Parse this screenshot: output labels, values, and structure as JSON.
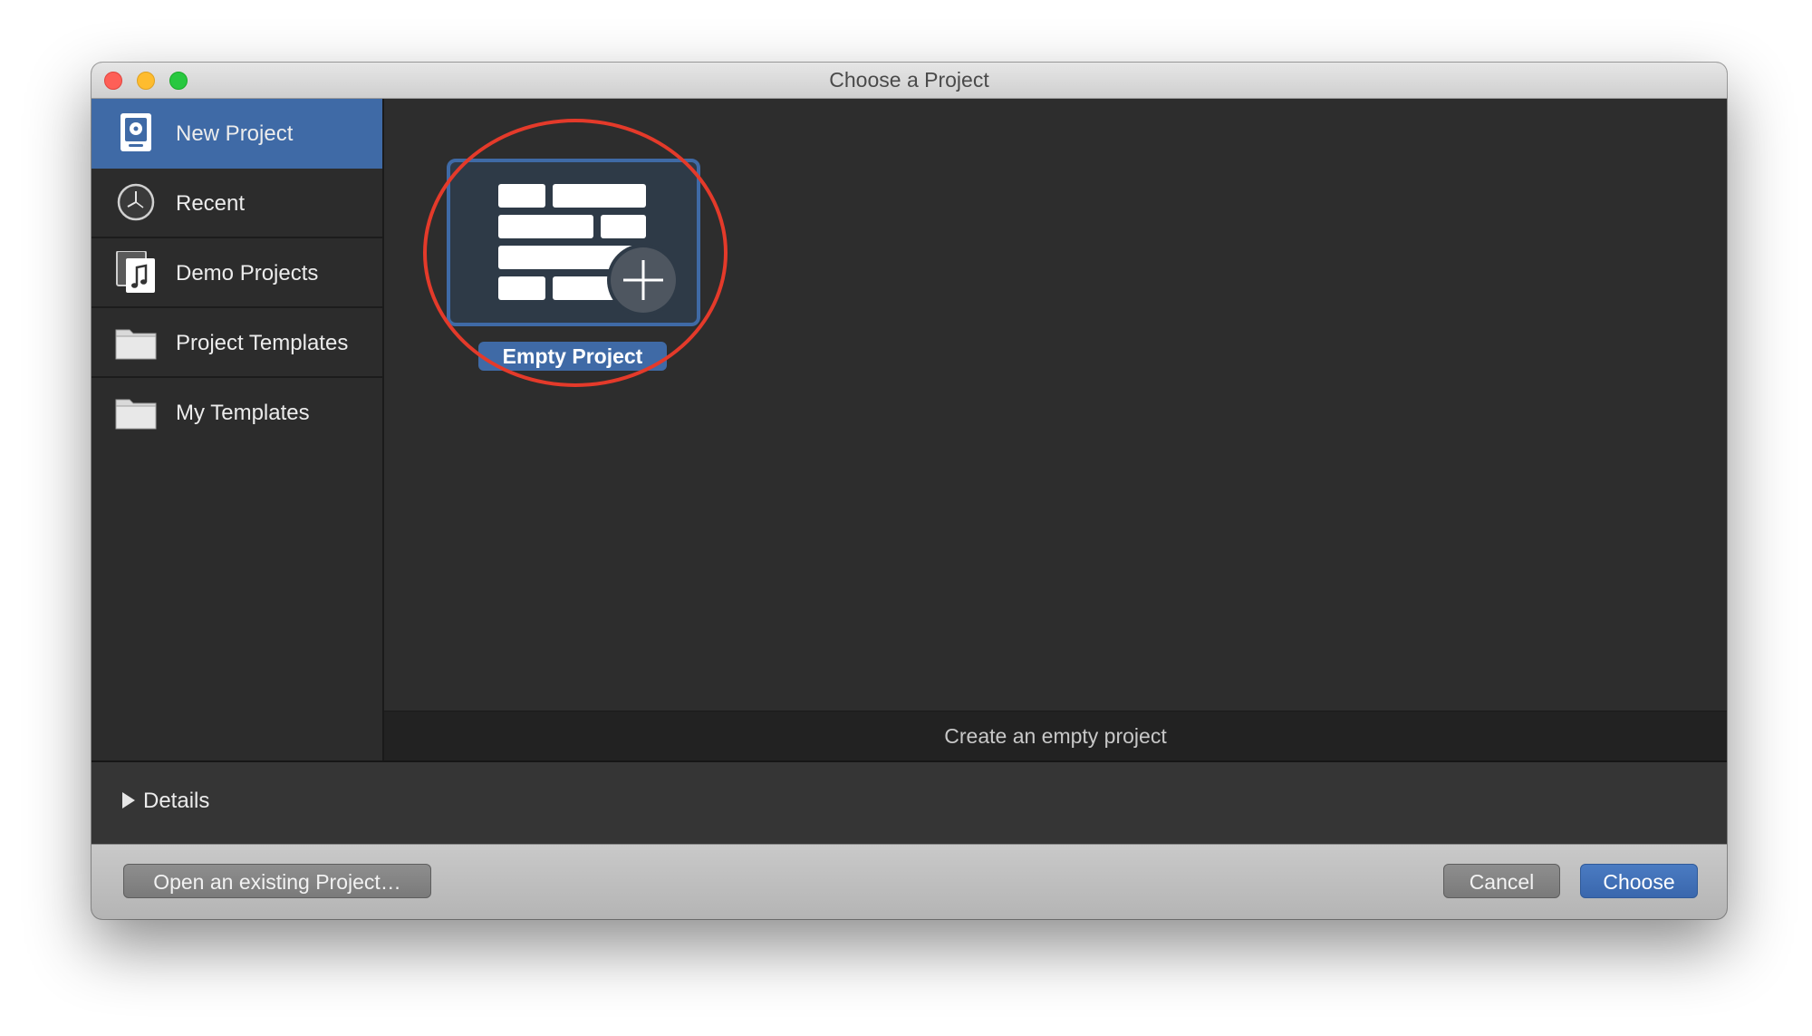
{
  "window": {
    "title": "Choose a Project"
  },
  "sidebar": {
    "items": [
      {
        "label": "New Project",
        "icon": "new-project-icon",
        "selected": true
      },
      {
        "label": "Recent",
        "icon": "clock-icon",
        "selected": false
      },
      {
        "label": "Demo Projects",
        "icon": "music-document-icon",
        "selected": false
      },
      {
        "label": "Project Templates",
        "icon": "folder-icon",
        "selected": false
      },
      {
        "label": "My Templates",
        "icon": "folder-icon",
        "selected": false
      }
    ]
  },
  "gallery": {
    "items": [
      {
        "label": "Empty Project",
        "icon": "empty-project-icon",
        "selected": true
      }
    ]
  },
  "description": {
    "text": "Create an empty project"
  },
  "details": {
    "label": "Details",
    "expanded": false
  },
  "footer": {
    "open_label": "Open an existing Project…",
    "cancel_label": "Cancel",
    "choose_label": "Choose"
  },
  "colors": {
    "accent": "#3f6aa6",
    "highlight_ring": "#e43a2a",
    "sidebar_bg": "#2c2c2c",
    "content_bg": "#2d2d2d"
  }
}
